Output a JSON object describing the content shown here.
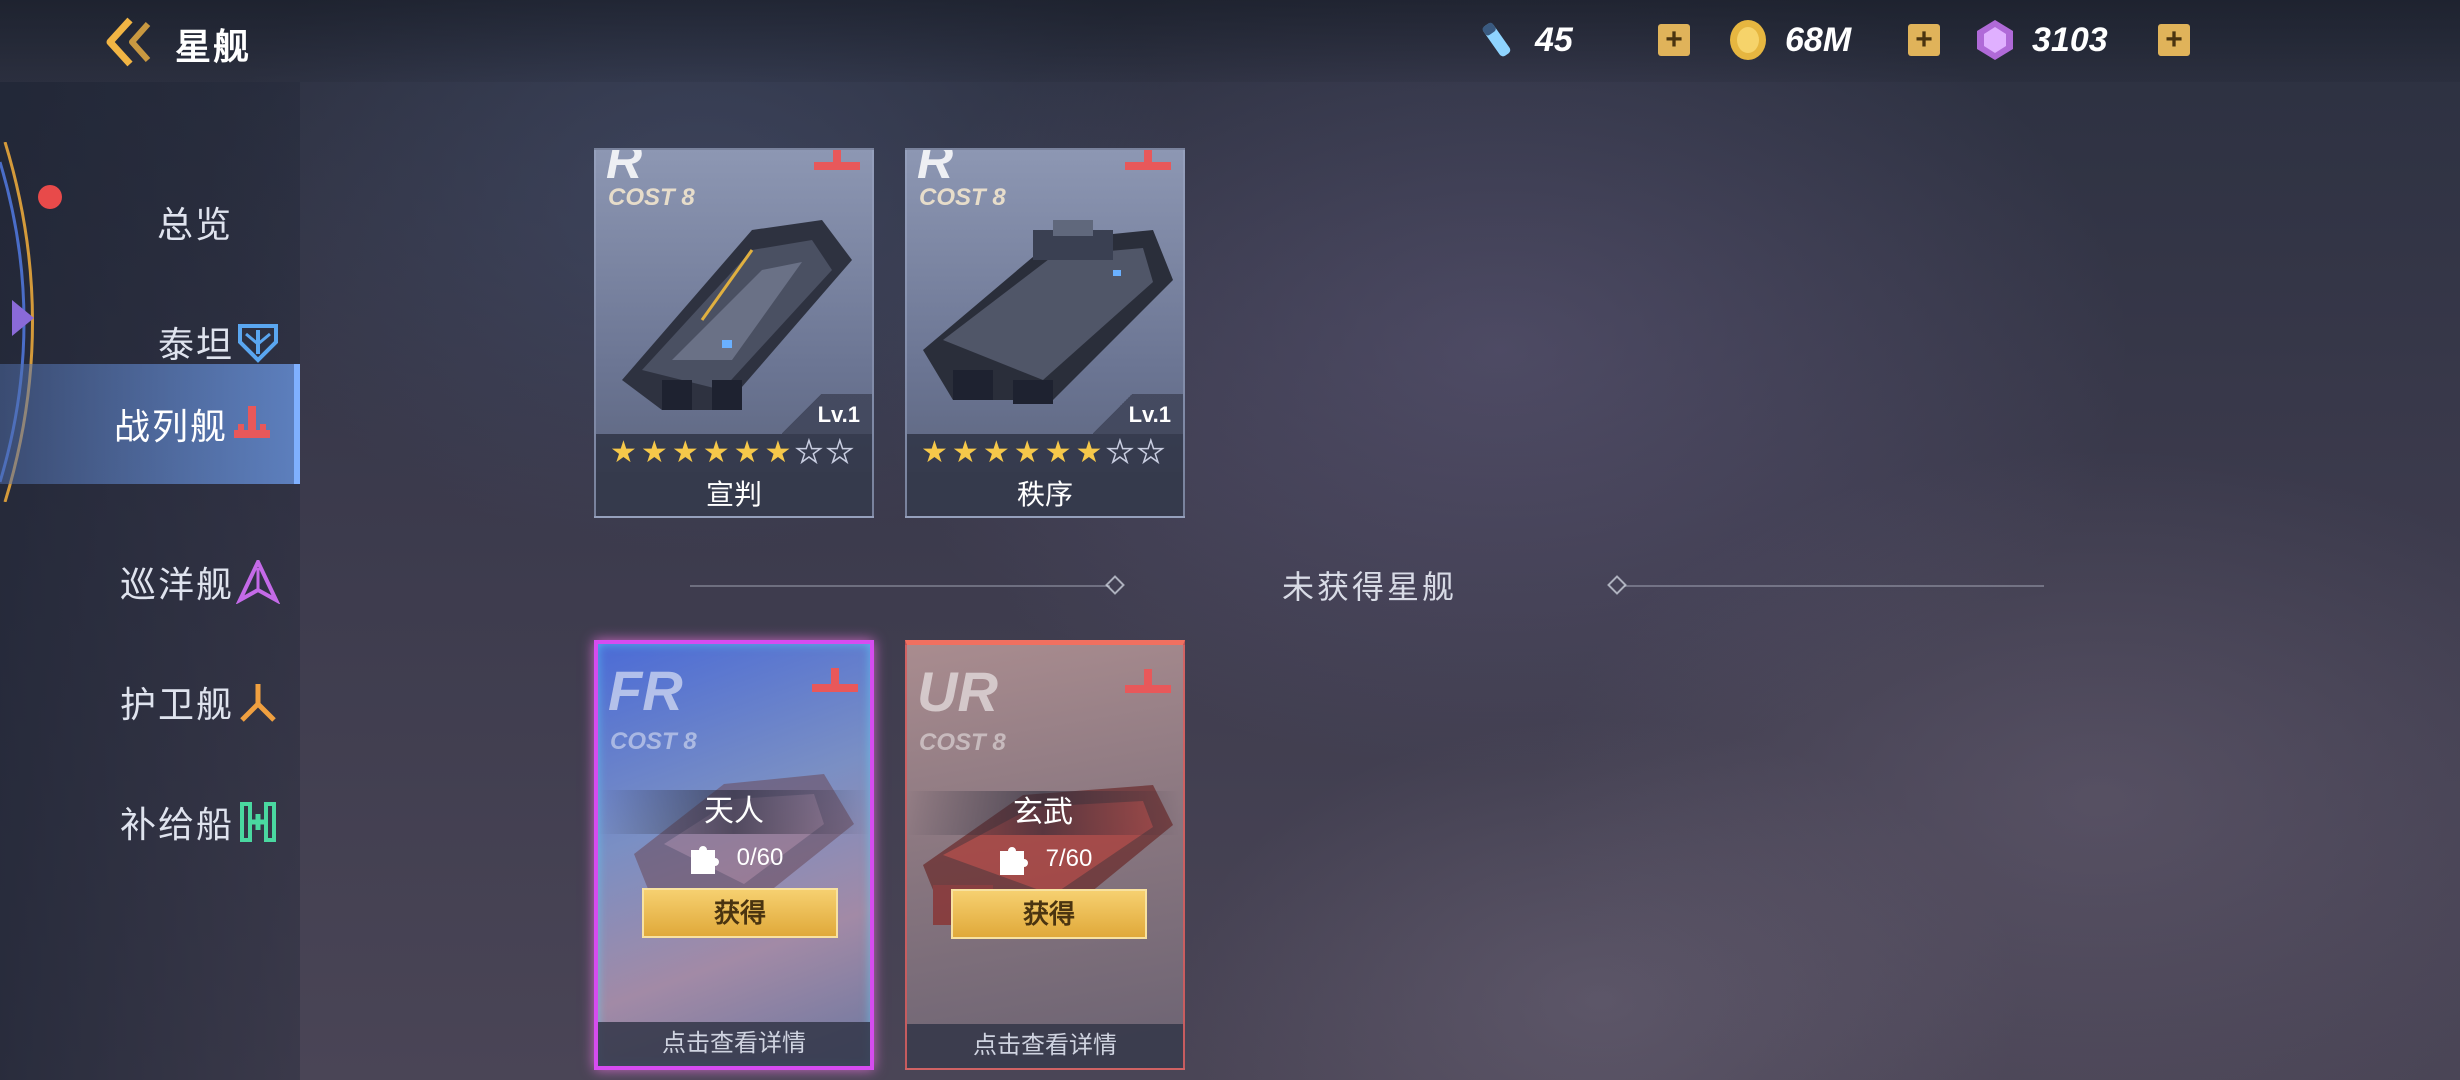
{
  "header": {
    "title": "星舰",
    "resources": [
      {
        "icon": "energy-vial-icon",
        "value": "45"
      },
      {
        "icon": "gold-coin-icon",
        "value": "68M"
      },
      {
        "icon": "purple-crystal-icon",
        "value": "3103"
      }
    ],
    "plus_label": "+"
  },
  "sidebar": {
    "items": [
      {
        "label": "总览",
        "icon": ""
      },
      {
        "label": "泰坦",
        "icon": "titan-icon"
      },
      {
        "label": "战列舰",
        "icon": "battleship-icon",
        "active": true
      },
      {
        "label": "巡洋舰",
        "icon": "cruiser-icon"
      },
      {
        "label": "护卫舰",
        "icon": "frigate-icon"
      },
      {
        "label": "补给船",
        "icon": "supply-ship-icon"
      }
    ]
  },
  "owned_ships": [
    {
      "rarity": "R",
      "cost": "COST 8",
      "level": "Lv.1",
      "stars_filled": 6,
      "stars_total": 8,
      "name": "宣判"
    },
    {
      "rarity": "R",
      "cost": "COST 8",
      "level": "Lv.1",
      "stars_filled": 6,
      "stars_total": 8,
      "name": "秩序"
    }
  ],
  "section": {
    "title": "未获得星舰"
  },
  "locked_ships": [
    {
      "rarity": "FR",
      "cost": "COST 8",
      "name": "天人",
      "fragments": "0/60",
      "button": "获得",
      "detail": "点击查看详情"
    },
    {
      "rarity": "UR",
      "cost": "COST 8",
      "name": "玄武",
      "fragments": "7/60",
      "button": "获得",
      "detail": "点击查看详情"
    }
  ],
  "colors": {
    "accent_gold": "#e0b35a",
    "active_tab": "#6a93d8",
    "fr_border": "#d64cf0",
    "ur_border": "#f07060",
    "type_mark": "#e8585a"
  }
}
